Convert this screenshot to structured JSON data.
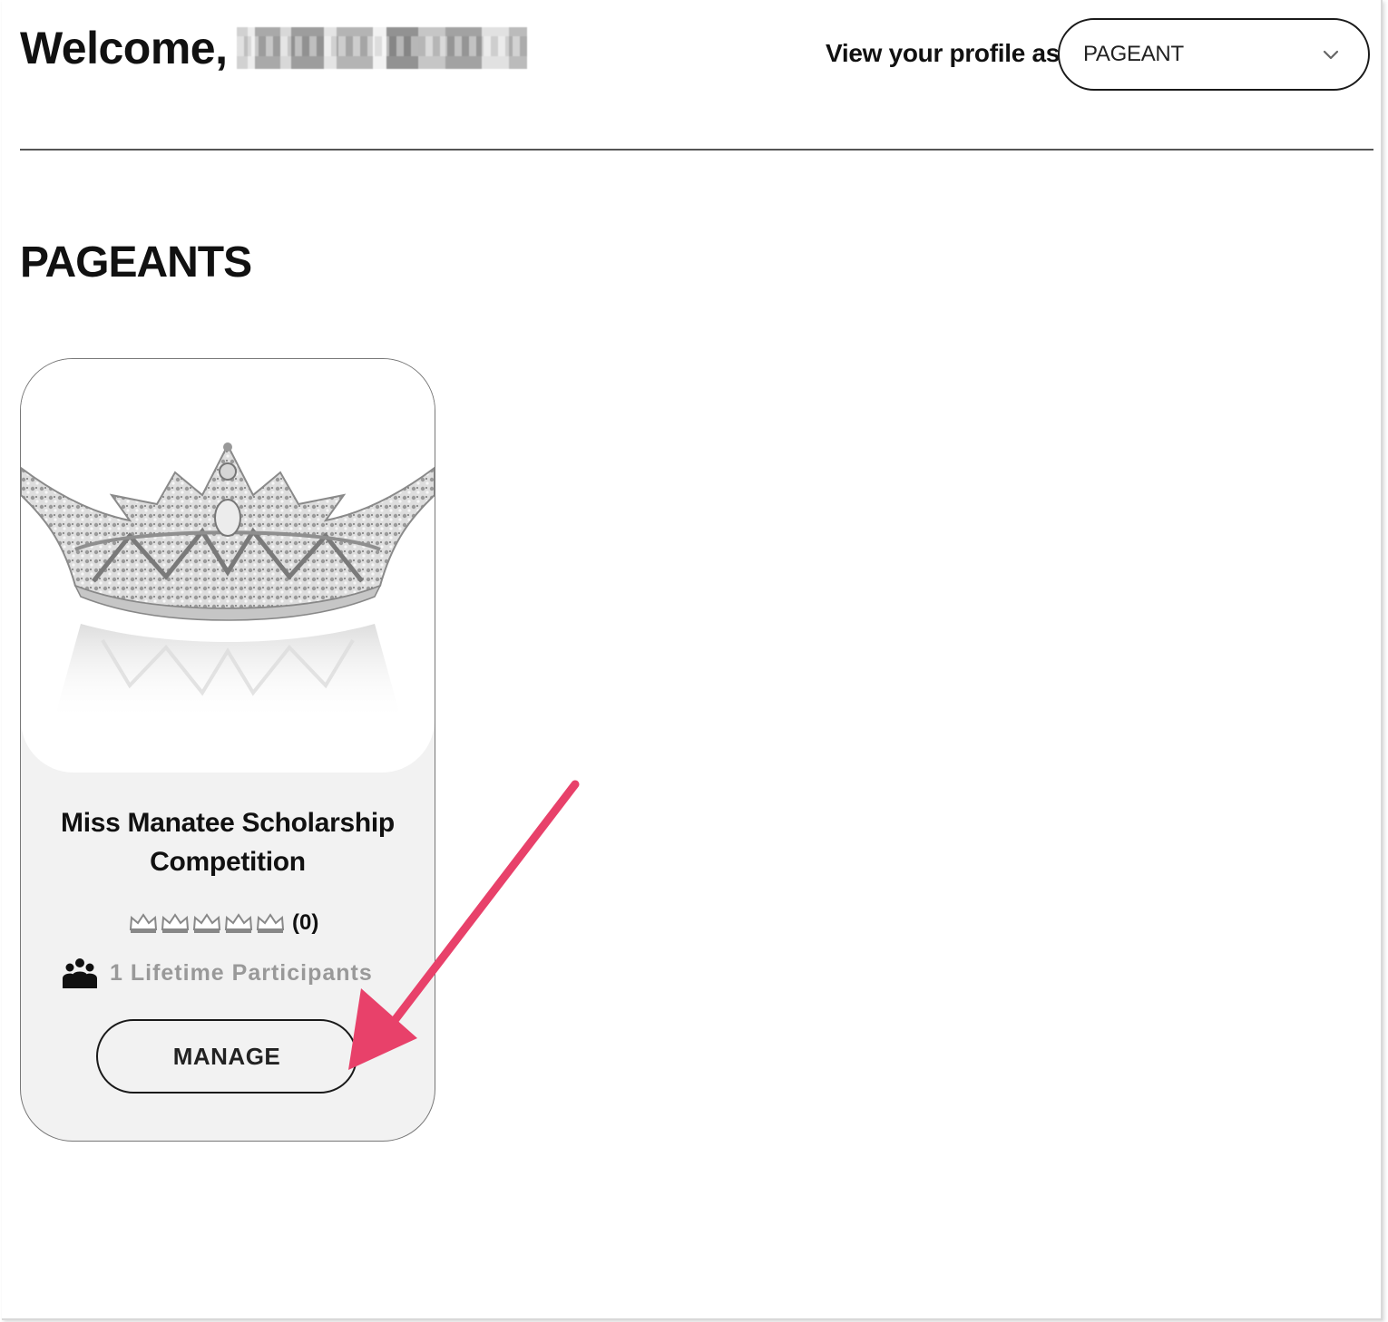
{
  "header": {
    "welcome_label": "Welcome,",
    "view_as_label": "View your profile as",
    "view_as_value": "PAGEANT"
  },
  "section": {
    "title": "PAGEANTS"
  },
  "pageants": [
    {
      "title": "Miss Manatee Scholarship Competition",
      "rating": 0,
      "rating_max": 5,
      "rating_count": "(0)",
      "participants": "1 Lifetime Participants",
      "manage_label": "MANAGE"
    }
  ],
  "colors": {
    "arrow": "#e8416a",
    "card_bg": "#f2f2f2",
    "border": "#1a1a1a",
    "muted_text": "#999999"
  },
  "icons": {
    "dropdown": "chevron-down-icon",
    "rating": "crown-icon",
    "participants": "people-icon",
    "annotation": "arrow-annotation"
  }
}
